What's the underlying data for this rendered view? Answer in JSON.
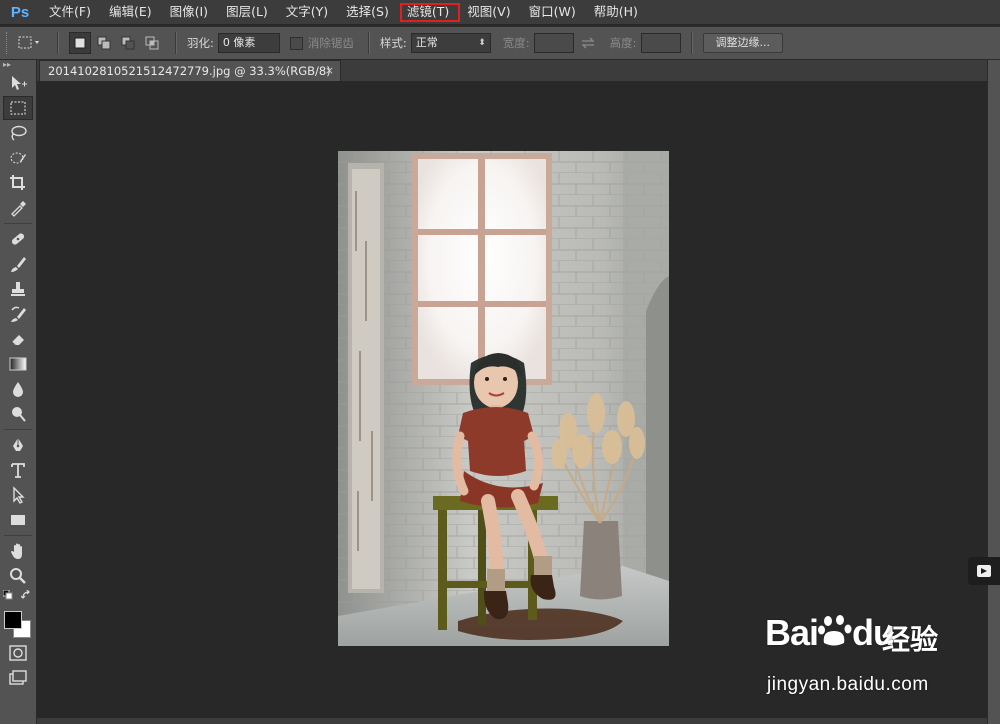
{
  "app": {
    "logo": "Ps"
  },
  "menu": [
    {
      "label": "文件(F)"
    },
    {
      "label": "编辑(E)"
    },
    {
      "label": "图像(I)"
    },
    {
      "label": "图层(L)"
    },
    {
      "label": "文字(Y)"
    },
    {
      "label": "选择(S)"
    },
    {
      "label": "滤镜(T)",
      "highlighted": true
    },
    {
      "label": "视图(V)"
    },
    {
      "label": "窗口(W)"
    },
    {
      "label": "帮助(H)"
    }
  ],
  "options": {
    "feather_label": "羽化:",
    "feather_value": "0 像素",
    "antialias_label": "消除锯齿",
    "style_label": "样式:",
    "style_value": "正常",
    "width_label": "宽度:",
    "height_label": "高度:",
    "refine_edge_button": "调整边缘..."
  },
  "document": {
    "tab_title": "20141028105215124727­79.jpg @ 33.3%(RGB/8)",
    "close_glyph": "×"
  },
  "watermark": {
    "brand": "Bai",
    "brand_suffix": "du",
    "product": "经验",
    "url": "jingyan.baidu.com"
  },
  "colors": {
    "highlight": "#e02020",
    "ps_blue": "#5fb4ff",
    "foreground": "#000000",
    "background": "#ffffff"
  }
}
